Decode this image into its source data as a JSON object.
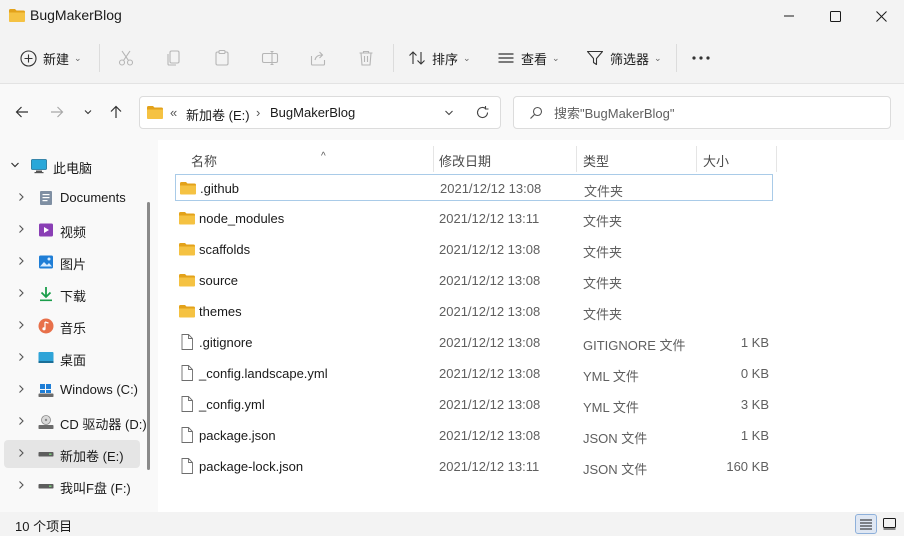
{
  "window": {
    "title": "BugMakerBlog",
    "minimize_icon": "minimize-icon",
    "maximize_icon": "maximize-icon",
    "close_icon": "close-icon"
  },
  "toolbar": {
    "new_label": "新建",
    "sort_label": "排序",
    "view_label": "查看",
    "filter_label": "筛选器",
    "icons": [
      "cut-icon",
      "copy-icon",
      "paste-icon",
      "rename-icon",
      "share-icon",
      "delete-icon",
      "more-icon"
    ]
  },
  "address": {
    "overflow": "«",
    "drive": "新加卷 (E:)",
    "separator": "›",
    "folder": "BugMakerBlog"
  },
  "search": {
    "placeholder": "搜索\"BugMakerBlog\""
  },
  "sidebar": {
    "items": [
      {
        "label": "此电脑",
        "icon": "pc-icon"
      },
      {
        "label": "Documents",
        "icon": "documents-icon"
      },
      {
        "label": "视频",
        "icon": "videos-icon"
      },
      {
        "label": "图片",
        "icon": "pictures-icon"
      },
      {
        "label": "下载",
        "icon": "downloads-icon"
      },
      {
        "label": "音乐",
        "icon": "music-icon"
      },
      {
        "label": "桌面",
        "icon": "desktop-icon"
      },
      {
        "label": "Windows (C:)",
        "icon": "windows-drive-icon"
      },
      {
        "label": "CD 驱动器 (D:)",
        "icon": "cd-drive-icon"
      },
      {
        "label": "新加卷 (E:)",
        "icon": "drive-icon"
      },
      {
        "label": "我叫F盘 (F:)",
        "icon": "drive-icon"
      }
    ]
  },
  "columns": {
    "name": "名称",
    "modified": "修改日期",
    "type": "类型",
    "size": "大小"
  },
  "files": [
    {
      "name": ".github",
      "modified": "2021/12/12 13:08",
      "type": "文件夹",
      "size": "",
      "kind": "folder"
    },
    {
      "name": "node_modules",
      "modified": "2021/12/12 13:11",
      "type": "文件夹",
      "size": "",
      "kind": "folder"
    },
    {
      "name": "scaffolds",
      "modified": "2021/12/12 13:08",
      "type": "文件夹",
      "size": "",
      "kind": "folder"
    },
    {
      "name": "source",
      "modified": "2021/12/12 13:08",
      "type": "文件夹",
      "size": "",
      "kind": "folder"
    },
    {
      "name": "themes",
      "modified": "2021/12/12 13:08",
      "type": "文件夹",
      "size": "",
      "kind": "folder"
    },
    {
      "name": ".gitignore",
      "modified": "2021/12/12 13:08",
      "type": "GITIGNORE 文件",
      "size": "1 KB",
      "kind": "file"
    },
    {
      "name": "_config.landscape.yml",
      "modified": "2021/12/12 13:08",
      "type": "YML 文件",
      "size": "0 KB",
      "kind": "file"
    },
    {
      "name": "_config.yml",
      "modified": "2021/12/12 13:08",
      "type": "YML 文件",
      "size": "3 KB",
      "kind": "file"
    },
    {
      "name": "package.json",
      "modified": "2021/12/12 13:08",
      "type": "JSON 文件",
      "size": "1 KB",
      "kind": "file"
    },
    {
      "name": "package-lock.json",
      "modified": "2021/12/12 13:11",
      "type": "JSON 文件",
      "size": "160 KB",
      "kind": "file"
    }
  ],
  "status": {
    "item_count": "10 个项目"
  },
  "colors": {
    "folder": "#f5c242",
    "folder_dark": "#e3a21a",
    "accent": "#0067c0"
  }
}
